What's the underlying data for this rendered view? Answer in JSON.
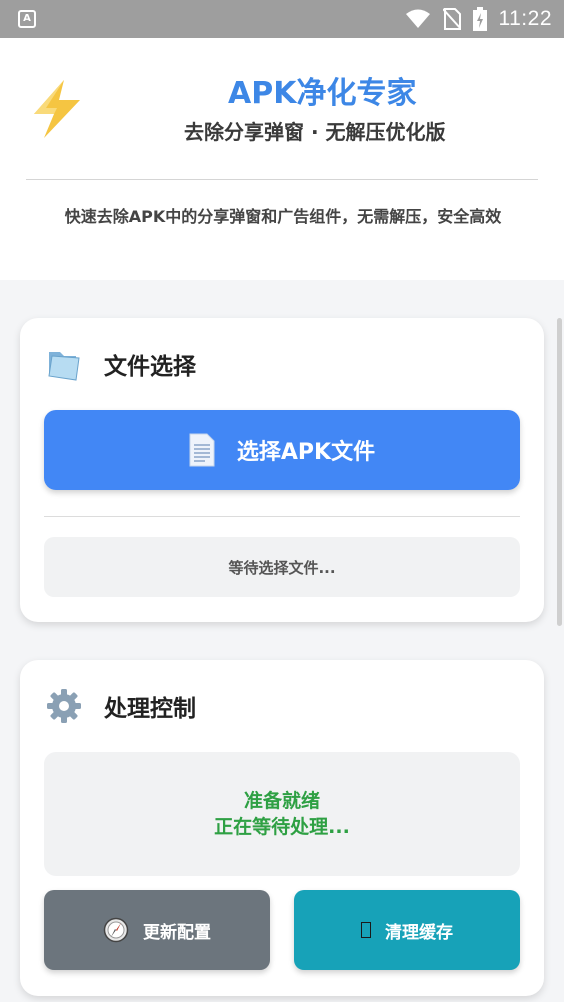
{
  "status_bar": {
    "time": "11:22",
    "icons": [
      "a-notification-icon",
      "wifi-icon",
      "no-sim-icon",
      "battery-charging-icon"
    ]
  },
  "header": {
    "logo_icon": "lightning-bolt-icon",
    "title": "APK净化专家",
    "subtitle": "去除分享弹窗 · 无解压优化版",
    "description": "快速去除APK中的分享弹窗和广告组件，无需解压，安全高效"
  },
  "file_card": {
    "icon": "folder-icon",
    "title": "文件选择",
    "select_button": {
      "icon": "document-icon",
      "label": "选择APK文件"
    },
    "status": "等待选择文件..."
  },
  "process_card": {
    "icon": "gear-icon",
    "title": "处理控制",
    "status_line1": "准备就绪",
    "status_line2": "正在等待处理...",
    "update_button": {
      "icon": "compass-icon",
      "label": "更新配置"
    },
    "clear_button": {
      "icon": "missing-glyph-icon",
      "label": "清理缓存"
    }
  },
  "colors": {
    "accent": "#4287f5",
    "title_blue": "#3d87e6",
    "success_green": "#2ea043",
    "gray_button": "#6c757d",
    "teal_button": "#17a2b8"
  }
}
